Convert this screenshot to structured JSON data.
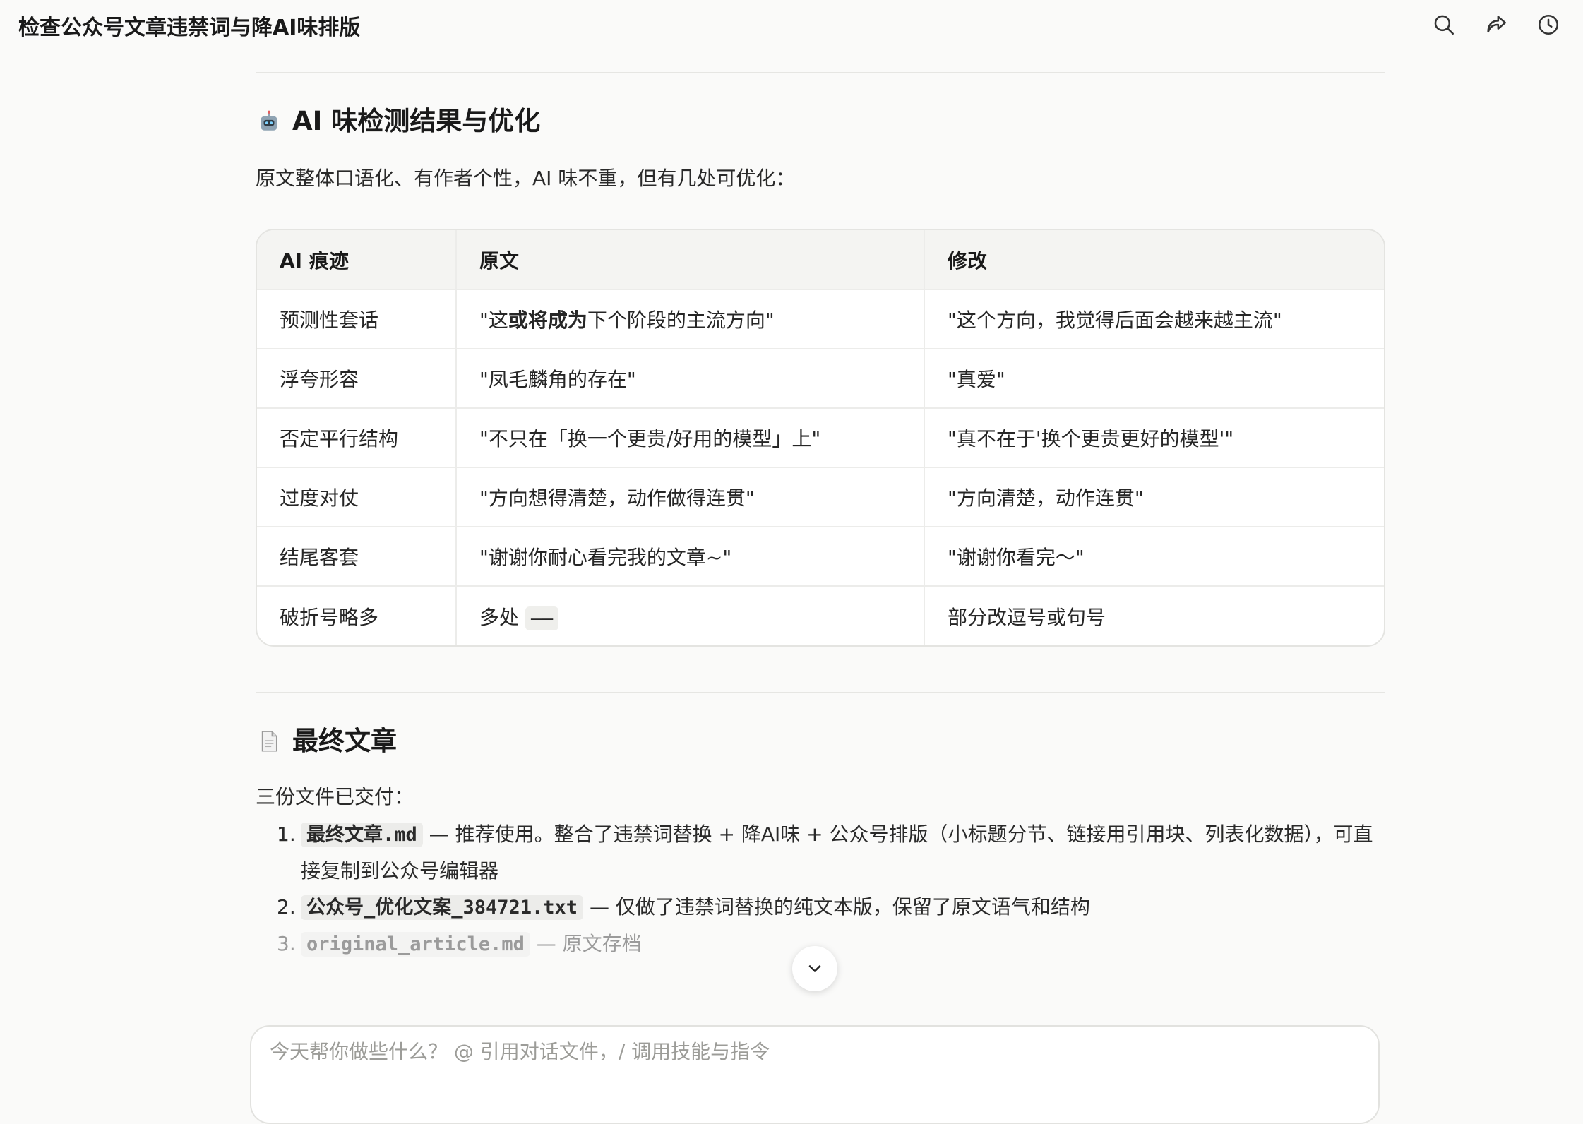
{
  "header": {
    "title": "检查公众号文章违禁词与降AI味排版",
    "icons": [
      "search-icon",
      "share-icon",
      "history-icon"
    ]
  },
  "ai_section": {
    "emoji": "robot-icon",
    "heading": "AI 味检测结果与优化",
    "intro": "原文整体口语化、有作者个性，AI 味不重，但有几处可优化："
  },
  "table": {
    "headers": [
      "AI 痕迹",
      "原文",
      "修改"
    ],
    "rows": [
      {
        "trace": "预测性套话",
        "orig_pre": "\"这",
        "orig_bold": "或将成为",
        "orig_post": "下个阶段的主流方向\"",
        "fix": "\"这个方向，我觉得后面会越来越主流\""
      },
      {
        "trace": "浮夸形容",
        "orig": "\"凤毛麟角的存在\"",
        "fix": "\"真爱\""
      },
      {
        "trace": "否定平行结构",
        "orig": "\"不只在「换一个更贵/好用的模型」上\"",
        "fix": "\"真不在于'换个更贵更好的模型'\""
      },
      {
        "trace": "过度对仗",
        "orig": "\"方向想得清楚，动作做得连贯\"",
        "fix": "\"方向清楚，动作连贯\""
      },
      {
        "trace": "结尾客套",
        "orig": "\"谢谢你耐心看完我的文章~\"",
        "fix": "\"谢谢你看完～\""
      },
      {
        "trace": "破折号略多",
        "orig_text": "多处",
        "orig_code": "——",
        "fix": "部分改逗号或句号"
      }
    ]
  },
  "final_section": {
    "emoji": "document-icon",
    "heading": "最终文章",
    "intro": "三份文件已交付：",
    "items": [
      {
        "num": "1.",
        "file": "最终文章.md",
        "desc": " — 推荐使用。整合了违禁词替换 + 降AI味 + 公众号排版（小标题分节、链接用引用块、列表化数据），可直接复制到公众号编辑器"
      },
      {
        "num": "2.",
        "file": "公众号_优化文案_384721.txt",
        "desc": " — 仅做了违禁词替换的纯文本版，保留了原文语气和结构"
      },
      {
        "num": "3.",
        "file": "original_article.md",
        "desc": " — 原文存档"
      }
    ]
  },
  "composer": {
    "placeholder": "今天帮你做些什么？ @ 引用对话文件，/ 调用技能与指令"
  },
  "accent": {
    "border": "#e4e4e1",
    "header_bg": "#f4f4f2"
  }
}
